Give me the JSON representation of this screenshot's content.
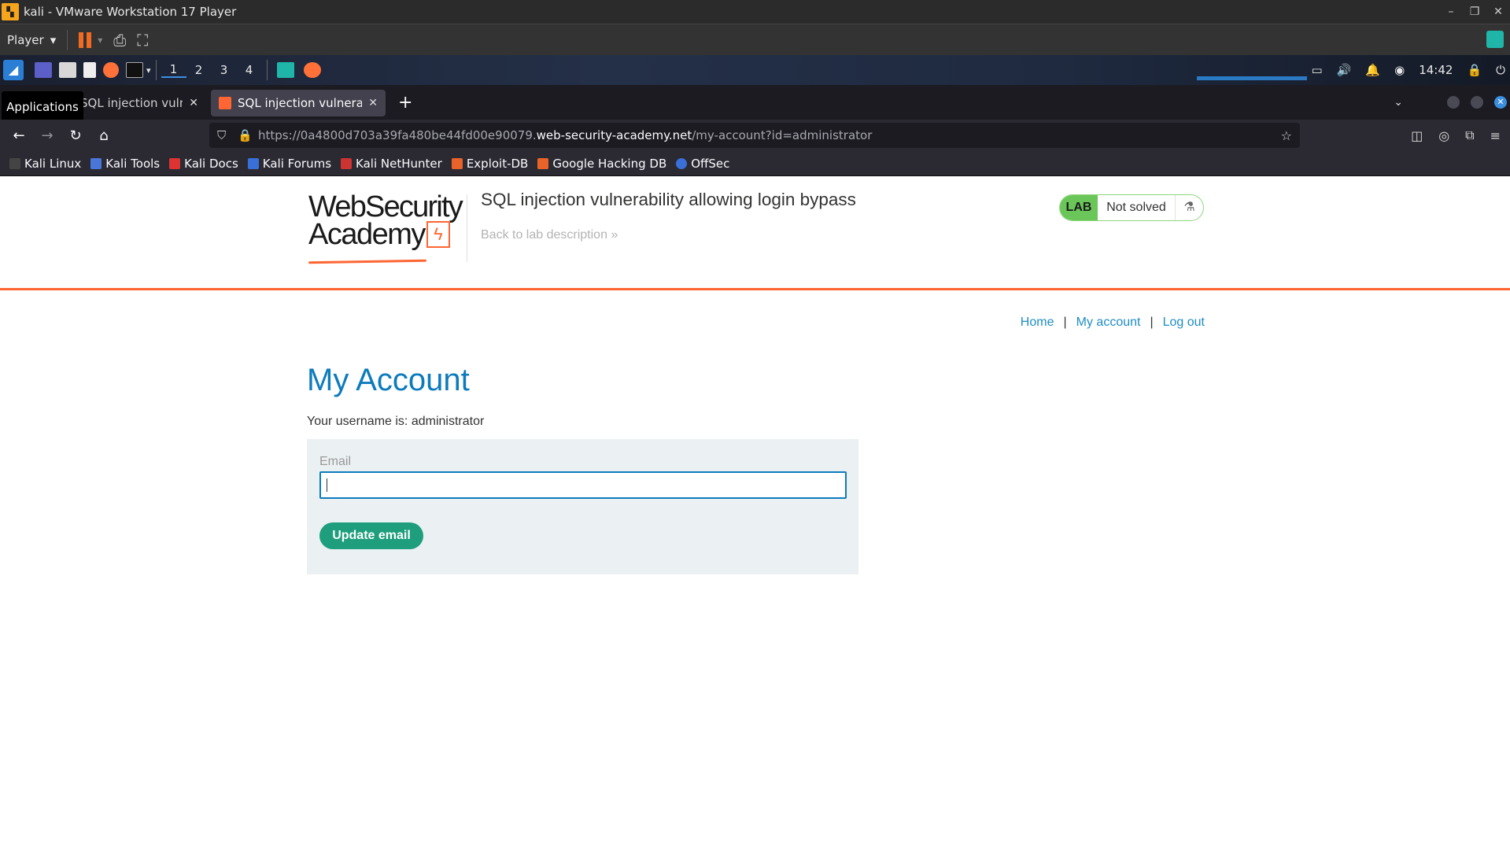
{
  "vm": {
    "title": "kali - VMware Workstation 17 Player",
    "player_menu": "Player",
    "win_controls": [
      "–",
      "❐",
      "✕"
    ]
  },
  "panel": {
    "workspaces": [
      "1",
      "2",
      "3",
      "4"
    ],
    "time": "14:42"
  },
  "browser": {
    "tooltip": "Applications",
    "tabs": [
      {
        "label": "SQL injection vulnera"
      },
      {
        "label": "SQL injection vulnerability"
      }
    ],
    "url_prefix": "https://0a4800d703a39fa480be44fd00e90079.",
    "url_host": "web-security-academy.net",
    "url_path": "/my-account?id=administrator",
    "bookmarks": [
      "Kali Linux",
      "Kali Tools",
      "Kali Docs",
      "Kali Forums",
      "Kali NetHunter",
      "Exploit-DB",
      "Google Hacking DB",
      "OffSec"
    ]
  },
  "page": {
    "logo_line1": "WebSecurity",
    "logo_line2": "Academy",
    "lab_title": "SQL injection vulnerability allowing login bypass",
    "back_link": "Back to lab description",
    "lab_badge": "LAB",
    "lab_status": "Not solved",
    "nav": {
      "home": "Home",
      "account": "My account",
      "logout": "Log out",
      "sep": "|"
    },
    "heading": "My Account",
    "username_text": "Your username is: administrator",
    "email_label": "Email",
    "email_value": "",
    "update_button": "Update email"
  },
  "colors": {
    "accent_orange": "#ff6633",
    "link_blue": "#1d8dc4",
    "heading_blue": "#0c7bbd",
    "button_green": "#1e9e7c",
    "lab_green": "#6bc65a"
  }
}
